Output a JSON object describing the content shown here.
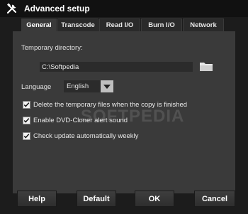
{
  "window": {
    "title": "Advanced setup"
  },
  "tabs": [
    {
      "label": "General",
      "active": true
    },
    {
      "label": "Transcode",
      "active": false
    },
    {
      "label": "Read I/O",
      "active": false
    },
    {
      "label": "Burn I/O",
      "active": false
    },
    {
      "label": "Network",
      "active": false
    }
  ],
  "general": {
    "temp_dir_label": "Temporary directory:",
    "temp_dir_value": "C:\\Softpedia",
    "language_label": "Language",
    "language_value": "English",
    "checkboxes": [
      {
        "label": "Delete the temporary files when the copy is finished",
        "checked": true
      },
      {
        "label": "Enable DVD-Cloner alert sound",
        "checked": true
      },
      {
        "label": "Check update automatically weekly",
        "checked": true
      }
    ]
  },
  "buttons": {
    "help": "Help",
    "default": "Default",
    "ok": "OK",
    "cancel": "Cancel"
  },
  "watermark": "SOFTPEDIA",
  "icons": {
    "title": "tools-icon",
    "folder": "folder-icon",
    "dropdown": "chevron-down-icon",
    "check": "checkmark-icon"
  },
  "colors": {
    "background": "#1c1c1c",
    "panel": "#3a3a3a",
    "field": "#2b2b2b",
    "checkbox": "#f2f2f2"
  }
}
